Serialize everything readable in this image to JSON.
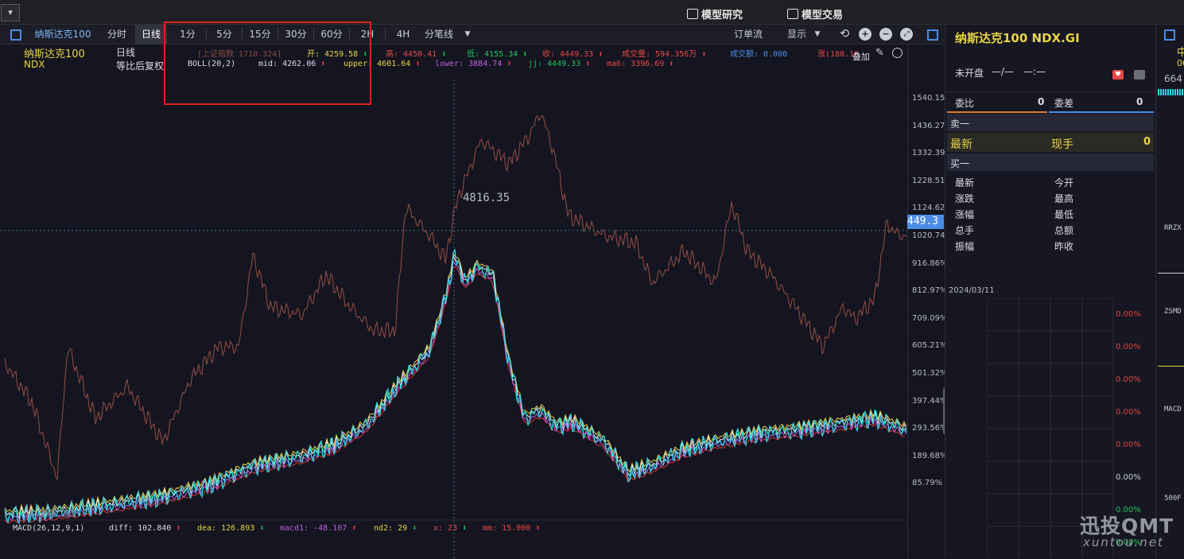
{
  "topbar": {
    "dropdown_symbol": "▾",
    "model_research": "模型研究",
    "model_trading": "模型交易"
  },
  "toolbar": {
    "symbol_tab": "纳斯达克100",
    "periods": [
      "分时",
      "日线",
      "1分",
      "5分",
      "15分",
      "30分",
      "60分",
      "2H",
      "4H",
      "分笔线"
    ],
    "active_period": "日线",
    "order_flow": "订单流",
    "display": "显示"
  },
  "chart_header": {
    "name": "纳斯达克100",
    "code": "NDX",
    "period": "日线",
    "adjust": "等比后复权",
    "overlay_index": "[上证指数 1710.324]",
    "open": "开: 4259.58",
    "high": "高: 4450.41",
    "low": "低: 4155.34",
    "close": "收: 4449.33",
    "volume": "成交量: 594.356万",
    "amount": "成交额: 0.000",
    "change": "涨(188.16",
    "overlay_btn": "叠加"
  },
  "indicator_line": {
    "name": "BOLL(20,2)",
    "mid": "mid: 4262.06",
    "upper": "upper: 4601.64",
    "lower": "lower: 3884.74",
    "jj": "jj: 4449.33",
    "ma6": "ma6: 3396.69"
  },
  "price_labels": {
    "peak": "4816.35",
    "bottom_left": "350.03",
    "cursor_price": "449.3"
  },
  "y_axis_ticks": [
    "1540.15%",
    "1436.27%",
    "1332.39%",
    "1228.51%",
    "1124.62%",
    "1020.74%",
    "916.86%",
    "812.97%",
    "709.09%",
    "605.21%",
    "501.32%",
    "397.44%",
    "293.56%",
    "189.68%",
    "85.79%"
  ],
  "macd_line": {
    "name": "MACD(26,12,9,1)",
    "diff": "diff: 102.840",
    "dea": "dea: 126.893",
    "macd1": "macd1: -48.107",
    "nd2": "nd2: 29",
    "x": "x: 23",
    "mm": "mm: 15.000"
  },
  "quote_panel": {
    "title": "纳斯达克100  NDX.GI",
    "status": "未开盘",
    "status_val1": "—/—",
    "status_val2": "—:—",
    "wei_bi": "委比",
    "wei_bi_val": "0",
    "wei_cha": "委差",
    "wei_cha_val": "0",
    "sell1": "卖一",
    "latest": "最新",
    "current_hand": "现手",
    "current_hand_val": "0",
    "buy1": "买一",
    "grid_left": [
      "最新",
      "涨跌",
      "涨幅",
      "总手",
      "振幅"
    ],
    "grid_right": [
      "今开",
      "最高",
      "最低",
      "总额",
      "昨收"
    ],
    "date": "2024/03/11",
    "pct_ticks": [
      "0.00%",
      "0.00%",
      "0.00%",
      "0.00%",
      "0.00%",
      "0.00%",
      "0.00%",
      "0.00%"
    ]
  },
  "far_right": {
    "char1": "中",
    "num1": "06",
    "num2": "664",
    "label1": "RRZX",
    "label2": "ZSMD",
    "label3": "MACD",
    "label4": "500F"
  },
  "watermark": {
    "brand": "迅投QMT",
    "url": "xuntou.net"
  },
  "colors": {
    "red_box": "#e02020",
    "price_brown": "#8b4a42",
    "up_red": "#e84848",
    "down_green": "#22c35e",
    "yellow": "#e8d44a",
    "accent_blue": "#4b8de6"
  }
}
